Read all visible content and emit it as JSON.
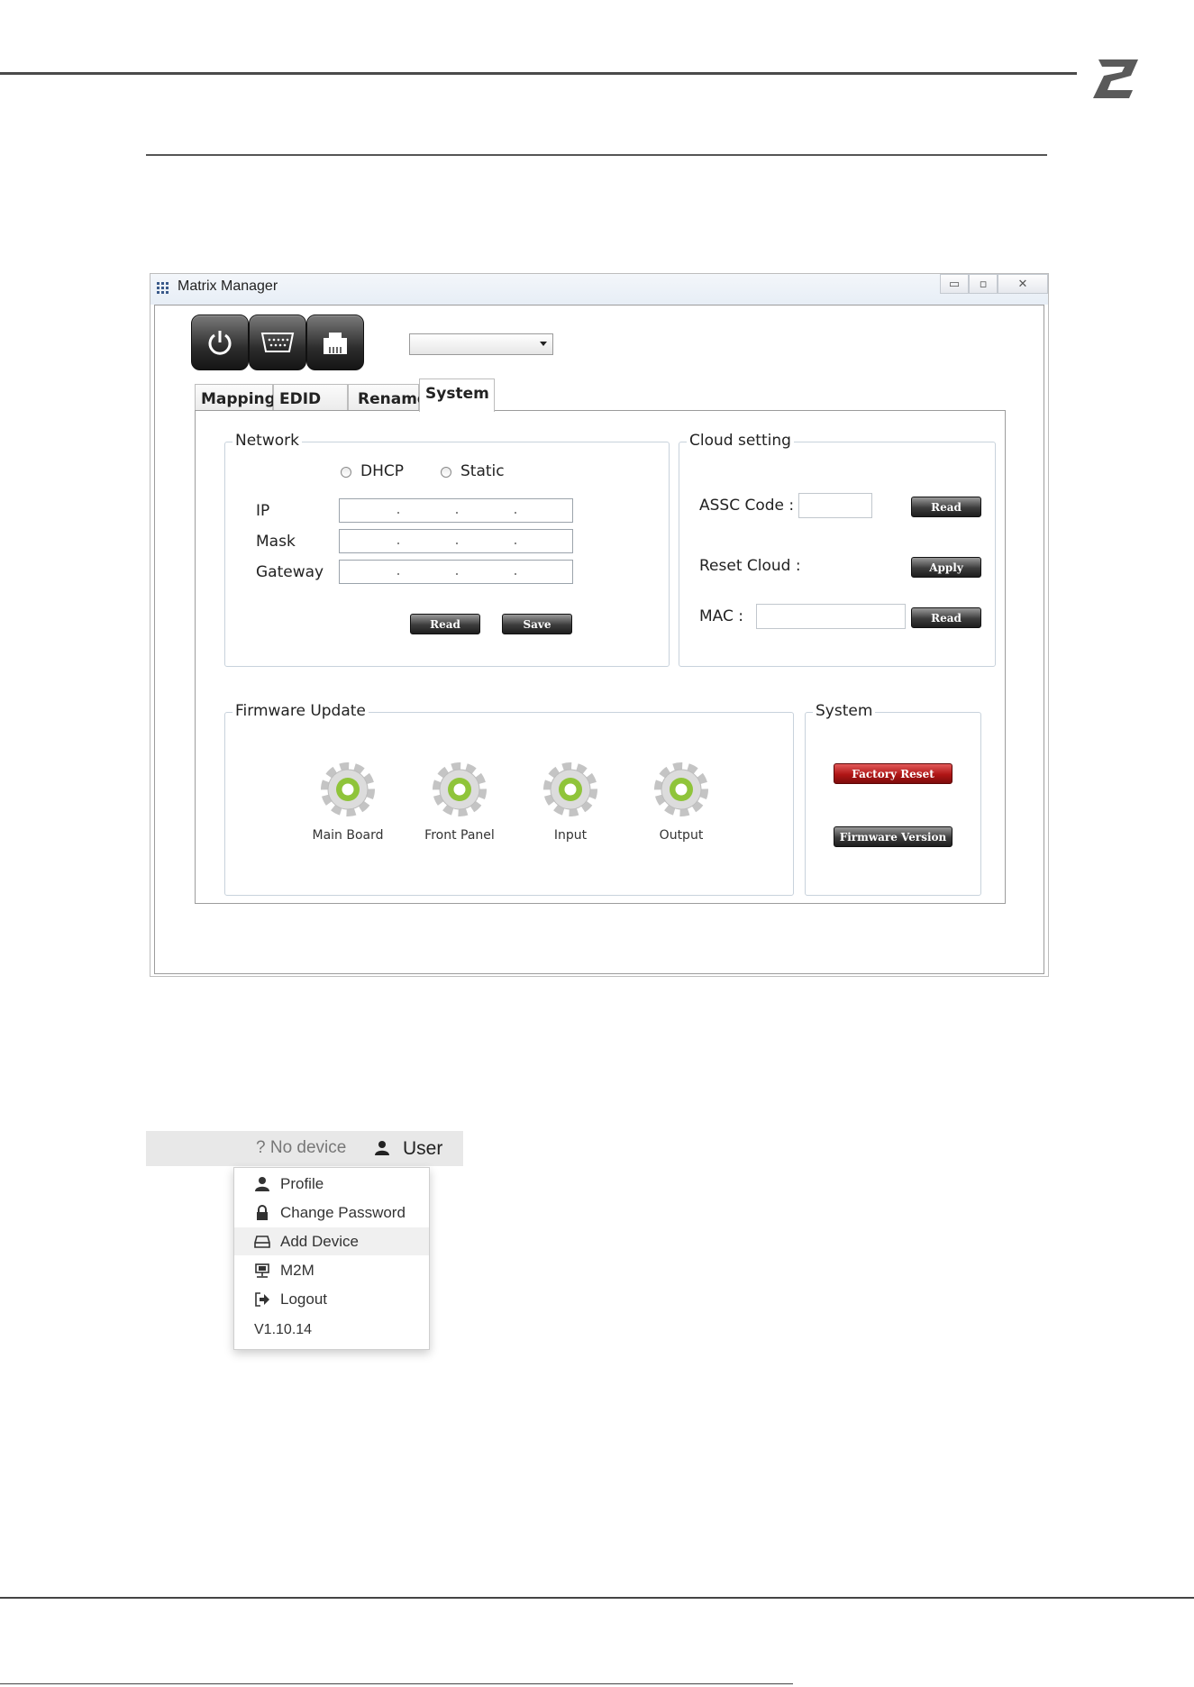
{
  "window": {
    "title": "Matrix Manager",
    "controls": [
      "minimize",
      "maximize",
      "close"
    ]
  },
  "toolbar": {
    "buttons": [
      "power-icon",
      "serial-port-icon",
      "ethernet-port-icon"
    ],
    "dropdown_value": ""
  },
  "tabs": [
    {
      "label": "Mapping",
      "active": false
    },
    {
      "label": "EDID",
      "active": false
    },
    {
      "label": "Rename",
      "active": false
    },
    {
      "label": "System",
      "active": true
    }
  ],
  "network": {
    "legend": "Network",
    "modes": [
      "DHCP",
      "Static"
    ],
    "fields": [
      {
        "label": "IP",
        "value": ""
      },
      {
        "label": "Mask",
        "value": ""
      },
      {
        "label": "Gateway",
        "value": ""
      }
    ],
    "read_label": "Read",
    "save_label": "Save"
  },
  "cloud": {
    "legend": "Cloud setting",
    "assc_label": "ASSC Code :",
    "assc_value": "",
    "assc_button": "Read",
    "reset_label": "Reset Cloud :",
    "reset_button": "Apply",
    "mac_label": "MAC :",
    "mac_value": "",
    "mac_button": "Read"
  },
  "firmware": {
    "legend": "Firmware Update",
    "items": [
      "Main Board",
      "Front Panel",
      "Input",
      "Output"
    ]
  },
  "system": {
    "legend": "System",
    "factory_reset": "Factory Reset",
    "firmware_version": "Firmware Version"
  },
  "web_menu": {
    "status": "? No device",
    "user": "User",
    "items": [
      {
        "label": "Profile",
        "icon": "user-icon"
      },
      {
        "label": "Change Password",
        "icon": "lock-icon"
      },
      {
        "label": "Add Device",
        "icon": "hard-drive-icon",
        "highlighted": true
      },
      {
        "label": "M2M",
        "icon": "network-icon"
      },
      {
        "label": "Logout",
        "icon": "logout-icon"
      }
    ],
    "version": "V1.10.14"
  },
  "colors": {
    "accent_green": "#8fc43a",
    "factory_reset_red": "#b01515"
  }
}
